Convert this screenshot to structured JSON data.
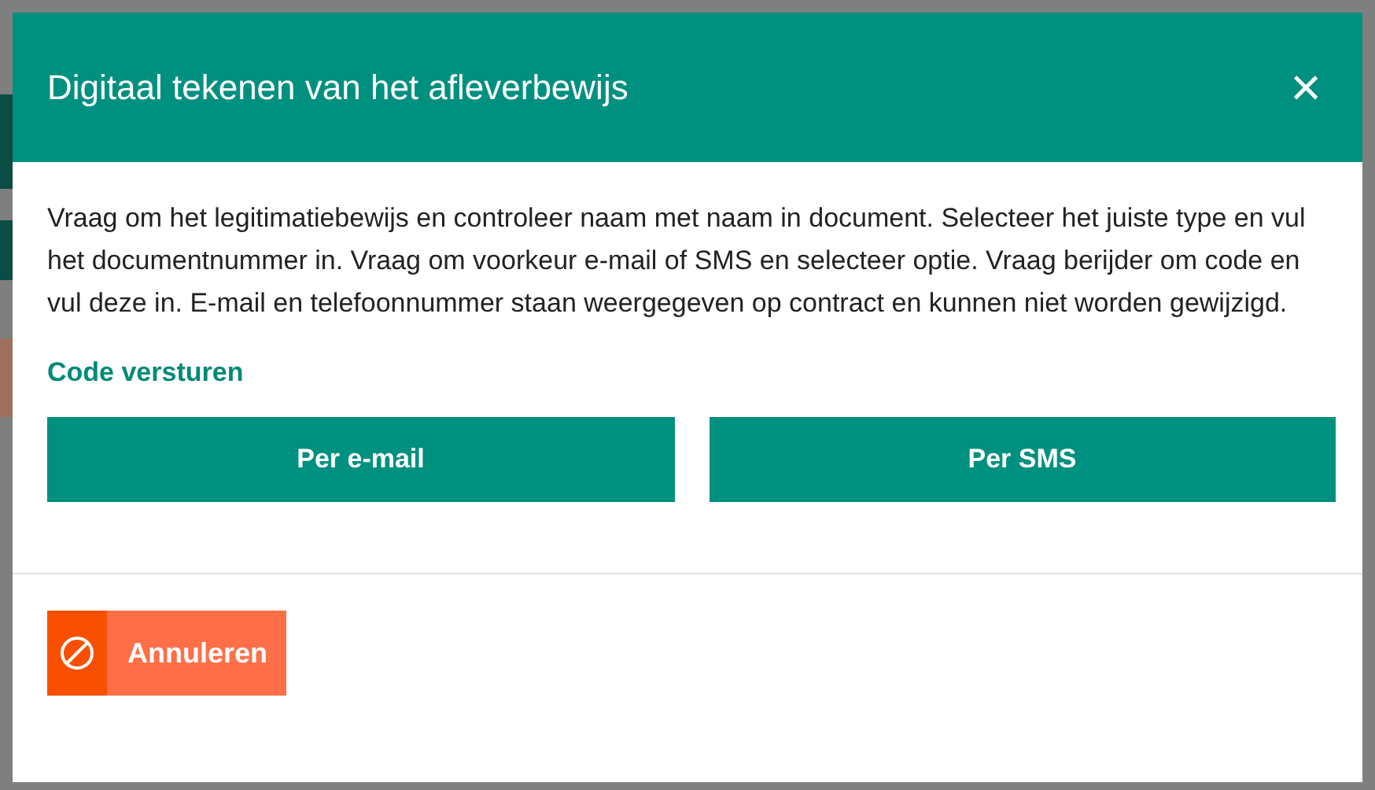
{
  "dialog": {
    "title": "Digitaal tekenen van het afleverbewijs",
    "close_label": "×",
    "instructions": "Vraag om het legitimatiebewijs en controleer naam met naam in document. Selecteer het juiste type en vul het documentnummer in. Vraag om voorkeur e-mail of SMS en selecteer optie. Vraag berijder om code en vul deze in. E-mail en telefoonnummer staan weergegeven op contract en kunnen niet worden gewijzigd.",
    "section_title": "Code versturen",
    "send_buttons": [
      {
        "label": "Per e-mail"
      },
      {
        "label": "Per SMS"
      }
    ],
    "cancel_button": {
      "label": "Annuleren"
    }
  }
}
